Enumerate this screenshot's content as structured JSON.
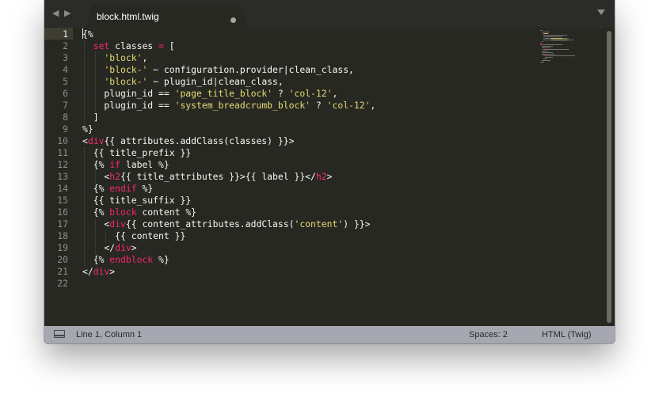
{
  "window": {
    "tab": {
      "title": "block.html.twig",
      "modified": true
    },
    "nav_icons": [
      "back-arrow-icon",
      "forward-arrow-icon"
    ]
  },
  "editor": {
    "lines": [
      [
        {
          "t": "{%",
          "c": ""
        }
      ],
      [
        {
          "t": "  ",
          "c": ""
        },
        {
          "t": "set",
          "c": "kw"
        },
        {
          "t": " classes ",
          "c": ""
        },
        {
          "t": "=",
          "c": "kw"
        },
        {
          "t": " [",
          "c": ""
        }
      ],
      [
        {
          "t": "    ",
          "c": ""
        },
        {
          "t": "'block'",
          "c": "str"
        },
        {
          "t": ",",
          "c": ""
        }
      ],
      [
        {
          "t": "    ",
          "c": ""
        },
        {
          "t": "'block-'",
          "c": "str"
        },
        {
          "t": " ~ configuration.provider|clean_class,",
          "c": ""
        }
      ],
      [
        {
          "t": "    ",
          "c": ""
        },
        {
          "t": "'block-'",
          "c": "str"
        },
        {
          "t": " ~ plugin_id|clean_class,",
          "c": ""
        }
      ],
      [
        {
          "t": "    plugin_id == ",
          "c": ""
        },
        {
          "t": "'page_title_block'",
          "c": "str"
        },
        {
          "t": " ? ",
          "c": ""
        },
        {
          "t": "'col-12'",
          "c": "str"
        },
        {
          "t": ",",
          "c": ""
        }
      ],
      [
        {
          "t": "    plugin_id == ",
          "c": ""
        },
        {
          "t": "'system_breadcrumb_block'",
          "c": "str"
        },
        {
          "t": " ? ",
          "c": ""
        },
        {
          "t": "'col-12'",
          "c": "str"
        },
        {
          "t": ",",
          "c": ""
        }
      ],
      [
        {
          "t": "  ]",
          "c": ""
        }
      ],
      [
        {
          "t": "%}",
          "c": ""
        }
      ],
      [
        {
          "t": "<",
          "c": ""
        },
        {
          "t": "div",
          "c": "tag"
        },
        {
          "t": "{{ attributes.addClass(classes) }}>",
          "c": ""
        }
      ],
      [
        {
          "t": "  {{ title_prefix }}",
          "c": ""
        }
      ],
      [
        {
          "t": "  {% ",
          "c": ""
        },
        {
          "t": "if",
          "c": "kw"
        },
        {
          "t": " label %}",
          "c": ""
        }
      ],
      [
        {
          "t": "    <",
          "c": ""
        },
        {
          "t": "h2",
          "c": "tag"
        },
        {
          "t": "{{ title_attributes }}>{{ label }}</",
          "c": ""
        },
        {
          "t": "h2",
          "c": "tag"
        },
        {
          "t": ">",
          "c": ""
        }
      ],
      [
        {
          "t": "  {% ",
          "c": ""
        },
        {
          "t": "endif",
          "c": "kw"
        },
        {
          "t": " %}",
          "c": ""
        }
      ],
      [
        {
          "t": "  {{ title_suffix }}",
          "c": ""
        }
      ],
      [
        {
          "t": "  {% ",
          "c": ""
        },
        {
          "t": "block",
          "c": "kw"
        },
        {
          "t": " content %}",
          "c": ""
        }
      ],
      [
        {
          "t": "    <",
          "c": ""
        },
        {
          "t": "div",
          "c": "tag"
        },
        {
          "t": "{{ content_attributes.addClass(",
          "c": ""
        },
        {
          "t": "'content'",
          "c": "str"
        },
        {
          "t": ") }}>",
          "c": ""
        }
      ],
      [
        {
          "t": "      {{ content }}",
          "c": ""
        }
      ],
      [
        {
          "t": "    </",
          "c": ""
        },
        {
          "t": "div",
          "c": "tag"
        },
        {
          "t": ">",
          "c": ""
        }
      ],
      [
        {
          "t": "  {% ",
          "c": ""
        },
        {
          "t": "endblock",
          "c": "kw"
        },
        {
          "t": " %}",
          "c": ""
        }
      ],
      [
        {
          "t": "</",
          "c": ""
        },
        {
          "t": "div",
          "c": "tag"
        },
        {
          "t": ">",
          "c": ""
        }
      ],
      []
    ],
    "current_line": 1
  },
  "statusbar": {
    "position": "Line 1, Column 1",
    "spaces": "Spaces: 2",
    "syntax": "HTML (Twig)"
  },
  "colors": {
    "background": "#272822",
    "keyword": "#f92672",
    "string": "#e6db74",
    "text": "#f8f8f2",
    "statusbar": "#a5a8b1"
  }
}
